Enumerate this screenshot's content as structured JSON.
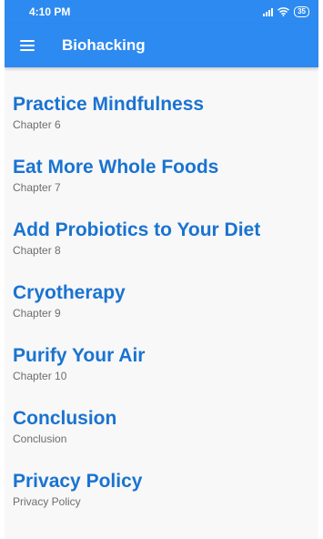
{
  "status_bar": {
    "time": "4:10 PM",
    "battery": "35"
  },
  "app_bar": {
    "menu_icon": "hamburger-menu-icon",
    "title": "Biohacking"
  },
  "chapters": [
    {
      "title": "Practice Mindfulness",
      "subtitle": "Chapter 6"
    },
    {
      "title": "Eat More Whole Foods",
      "subtitle": "Chapter 7"
    },
    {
      "title": "Add Probiotics to Your Diet",
      "subtitle": "Chapter 8"
    },
    {
      "title": "Cryotherapy",
      "subtitle": "Chapter 9"
    },
    {
      "title": "Purify Your Air",
      "subtitle": "Chapter 10"
    },
    {
      "title": "Conclusion",
      "subtitle": "Conclusion"
    },
    {
      "title": "Privacy Policy",
      "subtitle": "Privacy Policy"
    }
  ],
  "colors": {
    "primary": "#2d8af0",
    "title_text": "#1a73d1",
    "subtitle_text": "#6e6e6e"
  }
}
